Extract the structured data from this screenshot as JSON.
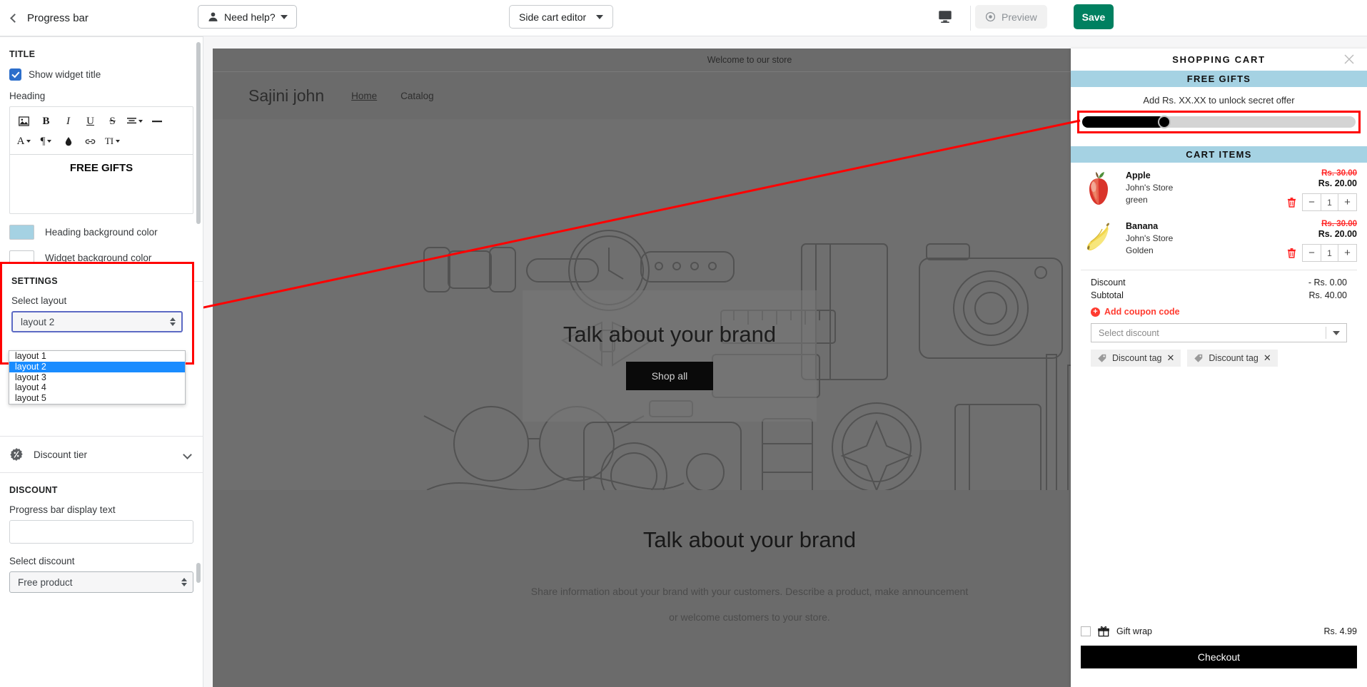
{
  "topbar": {
    "back_label": "Progress bar",
    "help_label": "Need help?",
    "editor_label": "Side cart editor",
    "preview_label": "Preview",
    "save_label": "Save",
    "save_color": "#008060"
  },
  "sidebar": {
    "title_section": {
      "heading": "TITLE",
      "show_widget_title_label": "Show widget title",
      "show_widget_title_checked": true,
      "heading_field_label": "Heading",
      "editor_content": "FREE GIFTS",
      "toolbar_row1": [
        "image-icon",
        "bold-icon",
        "italic-icon",
        "underline-icon",
        "strikethrough-icon",
        "align-icon",
        "horizontal-rule-icon"
      ],
      "toolbar_row2": [
        "font-color-icon",
        "paragraph-icon",
        "highlight-color-icon",
        "link-icon",
        "text-size-icon"
      ],
      "heading_bg_label": "Heading background color",
      "heading_bg_color": "#a5d2e3",
      "widget_bg_label": "Widget background color",
      "widget_bg_color": "#ffffff"
    },
    "settings_section": {
      "heading": "SETTINGS",
      "select_layout_label": "Select layout",
      "selected_layout": "layout 2",
      "layout_options": [
        "layout 1",
        "layout 2",
        "layout 3",
        "layout 4",
        "layout 5"
      ],
      "highlighted": true,
      "highlight_color": "#ff0000"
    },
    "discount_tier": {
      "label": "Discount tier",
      "expanded": false
    },
    "discount_section": {
      "heading": "DISCOUNT",
      "progress_text_label": "Progress bar display text",
      "progress_text_value": "",
      "select_discount_label": "Select discount",
      "selected_discount": "Free product"
    }
  },
  "store": {
    "announcement": "Welcome to our store",
    "brand": "Sajini john",
    "nav": [
      {
        "label": "Home",
        "active": true
      },
      {
        "label": "Catalog",
        "active": false
      }
    ],
    "hero": {
      "title": "Talk about your brand",
      "button": "Shop all"
    },
    "section2": {
      "title": "Talk about your brand",
      "line1": "Share information about your brand with your customers. Describe a product, make announcement",
      "line2": "or welcome customers to your store."
    }
  },
  "cart": {
    "title": "SHOPPING CART",
    "close_icon": "close-icon",
    "free_gifts_band": "FREE GIFTS",
    "gift_message": "Add Rs. XX.XX to unlock secret offer",
    "progress_percent": 30,
    "progress_highlighted": true,
    "cart_items_band": "CART ITEMS",
    "items": [
      {
        "name": "Apple",
        "store": "John's Store",
        "variant": "green",
        "price_old": "Rs. 30.00",
        "price_new": "Rs. 20.00",
        "qty": "1",
        "thumb": "apple-image"
      },
      {
        "name": "Banana",
        "store": "John's Store",
        "variant": "Golden",
        "price_old": "Rs. 30.00",
        "price_new": "Rs. 20.00",
        "qty": "1",
        "thumb": "banana-image"
      }
    ],
    "discount_label": "Discount",
    "discount_value": "- Rs. 0.00",
    "subtotal_label": "Subtotal",
    "subtotal_value": "Rs. 40.00",
    "add_coupon_label": "Add coupon code",
    "select_discount_placeholder": "Select discount",
    "discount_tags": [
      "Discount tag",
      "Discount tag"
    ],
    "giftwrap_label": "Gift wrap",
    "giftwrap_price": "Rs. 4.99",
    "giftwrap_checked": false,
    "checkout_label": "Checkout"
  }
}
